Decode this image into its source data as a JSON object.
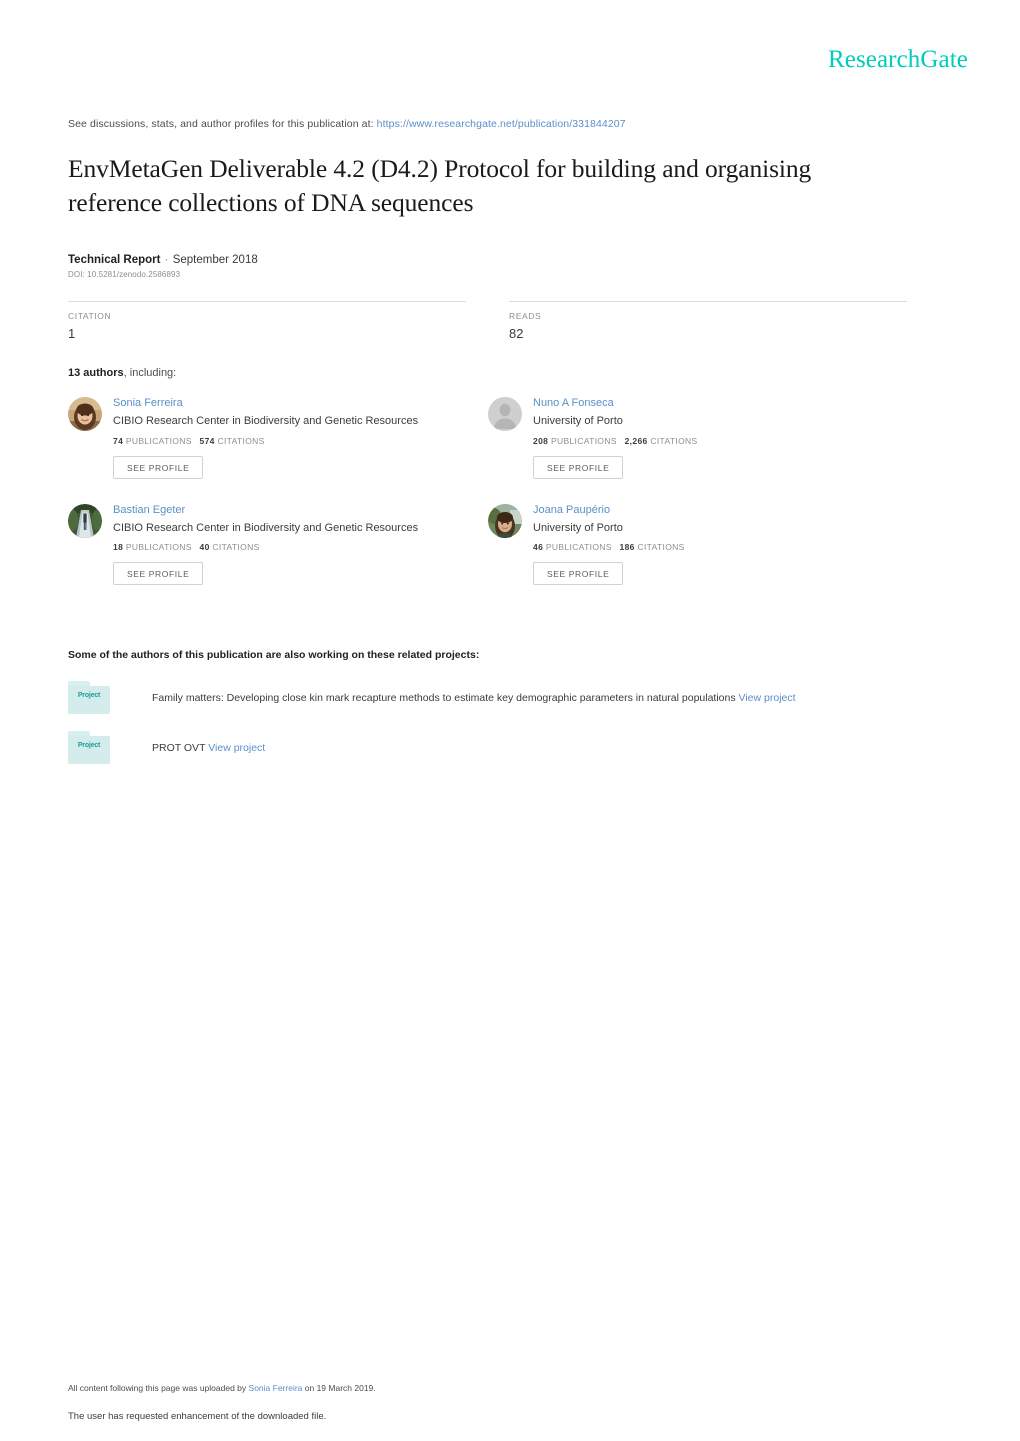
{
  "brand": {
    "name": "ResearchGate",
    "color": "#00ccbb"
  },
  "header": {
    "discussions_prefix": "See discussions, stats, and author profiles for this publication at:",
    "publication_url": "https://www.researchgate.net/publication/331844207"
  },
  "publication": {
    "title": "EnvMetaGen Deliverable 4.2 (D4.2) Protocol for building and organising reference collections of DNA sequences",
    "type": "Technical Report",
    "separator": "·",
    "date": "September 2018",
    "doi": "DOI: 10.5281/zenodo.2586893"
  },
  "stats": [
    {
      "label": "CITATION",
      "value": "1"
    },
    {
      "label": "READS",
      "value": "82"
    }
  ],
  "authors_section": {
    "count_text": "13 authors",
    "including_text": ", including:",
    "see_profile_label": "SEE PROFILE",
    "publications_label": "PUBLICATIONS",
    "citations_label": "CITATIONS",
    "authors": [
      {
        "name": "Sonia Ferreira",
        "affiliation": "CIBIO Research Center in Biodiversity and Genetic Resources",
        "publications": "74",
        "citations": "574",
        "avatar": "photo-avatar-sonia-ferreira"
      },
      {
        "name": "Nuno A Fonseca",
        "affiliation": "University of Porto",
        "publications": "208",
        "citations": "2,266",
        "avatar": "placeholder-avatar-icon"
      },
      {
        "name": "Bastian Egeter",
        "affiliation": "CIBIO Research Center in Biodiversity and Genetic Resources",
        "publications": "18",
        "citations": "40",
        "avatar": "photo-avatar-bastian-egeter"
      },
      {
        "name": "Joana Paupério",
        "affiliation": "University of Porto",
        "publications": "46",
        "citations": "186",
        "avatar": "photo-avatar-joana-pauperio"
      }
    ]
  },
  "projects_section": {
    "heading": "Some of the authors of this publication are also working on these related projects:",
    "icon_label": "Project",
    "view_project_label": "View project",
    "projects": [
      {
        "title": "Family matters: Developing close kin mark recapture methods to estimate key demographic parameters in natural populations"
      },
      {
        "title": "PROT OVT"
      }
    ]
  },
  "footer": {
    "line1_prefix": "All content following this page was uploaded by",
    "uploader": "Sonia Ferreira",
    "line1_suffix": "on 19 March 2019.",
    "line2": "The user has requested enhancement of the downloaded file."
  }
}
